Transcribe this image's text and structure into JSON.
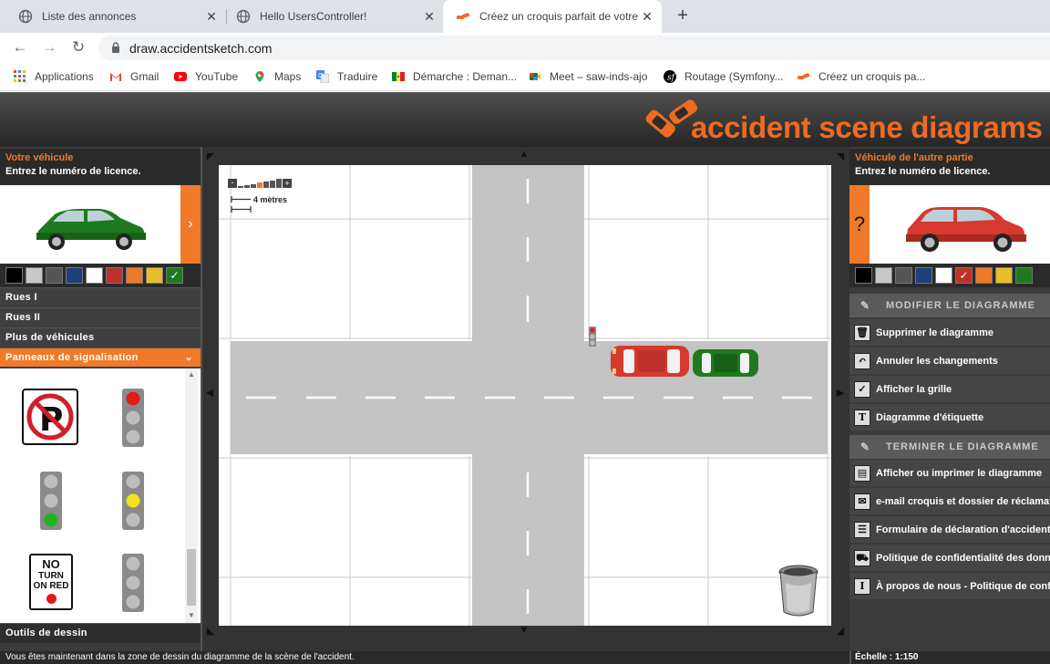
{
  "browser": {
    "tabs": [
      {
        "title": "Liste des annonces",
        "icon": "globe-icon"
      },
      {
        "title": "Hello UsersController!",
        "icon": "globe-icon"
      },
      {
        "title": "Créez un croquis parfait de votre",
        "icon": "cars-icon",
        "active": true
      }
    ],
    "url": "draw.accidentsketch.com",
    "bookmarks": [
      {
        "label": "Applications",
        "icon": "apps-grid-icon"
      },
      {
        "label": "Gmail",
        "icon": "gmail-icon"
      },
      {
        "label": "YouTube",
        "icon": "youtube-icon"
      },
      {
        "label": "Maps",
        "icon": "maps-icon"
      },
      {
        "label": "Traduire",
        "icon": "translate-icon"
      },
      {
        "label": "Démarche : Deman...",
        "icon": "flag-icon"
      },
      {
        "label": "Meet – saw-inds-ajo",
        "icon": "meet-icon"
      },
      {
        "label": "Routage (Symfony...",
        "icon": "symfony-icon"
      },
      {
        "label": "Créez un croquis pa...",
        "icon": "cars-icon"
      }
    ]
  },
  "app": {
    "logo_text": "accident scene diagrams",
    "left": {
      "title": "Votre véhicule",
      "subtitle": "Entrez le numéro de licence.",
      "arrow": "›",
      "colors": [
        "#000000",
        "#c8c8c8",
        "#555555",
        "#1e3f7a",
        "#ffffff",
        "#c0302a",
        "#ee7a25",
        "#e6c02a",
        "#1e7a1e"
      ],
      "selected_color": "#1e7a1e",
      "menu": [
        "Rues I",
        "Rues II",
        "Plus de véhicules",
        "Panneaux de signalisation"
      ],
      "open_menu": "Panneaux de signalisation",
      "tools_label": "Outils de dessin",
      "no_turn_sign": [
        "NO",
        "TURN",
        "ON RED"
      ]
    },
    "canvas": {
      "scale_label": "4 mètres",
      "zoom_level": 4
    },
    "right": {
      "title": "Véhicule de l'autre partie",
      "subtitle": "Entrez le numéro de licence.",
      "question": "?",
      "colors": [
        "#000000",
        "#c8c8c8",
        "#555555",
        "#1e3f7a",
        "#ffffff",
        "#c0302a",
        "#ee7a25",
        "#e6c02a",
        "#1e7a1e"
      ],
      "selected_color": "#c0302a",
      "section1": "MODIFIER LE DIAGRAMME",
      "actions1": [
        {
          "label": "Supprimer le diagramme",
          "icon": "trash-icon"
        },
        {
          "label": "Annuler les changements",
          "icon": "undo-icon"
        },
        {
          "label": "Afficher la grille",
          "icon": "grid-check-icon"
        },
        {
          "label": "Diagramme d'étiquette",
          "icon": "text-t-icon"
        }
      ],
      "section2": "TERMINER LE DIAGRAMME",
      "actions2": [
        {
          "label": "Afficher ou imprimer le diagramme",
          "icon": "print-icon"
        },
        {
          "label": "e-mail croquis et dossier de réclamat",
          "icon": "email-icon"
        },
        {
          "label": "Formulaire de déclaration d'accident",
          "icon": "form-icon"
        },
        {
          "label": "Politique de confidentialité des donn",
          "icon": "car-icon"
        },
        {
          "label": "À propos de nous - Politique de conf",
          "icon": "info-icon"
        }
      ]
    },
    "status_message": "Vous êtes maintenant dans la zone de dessin du diagramme de la scène de l'accident.",
    "status_scale": "Échelle : 1:150"
  }
}
